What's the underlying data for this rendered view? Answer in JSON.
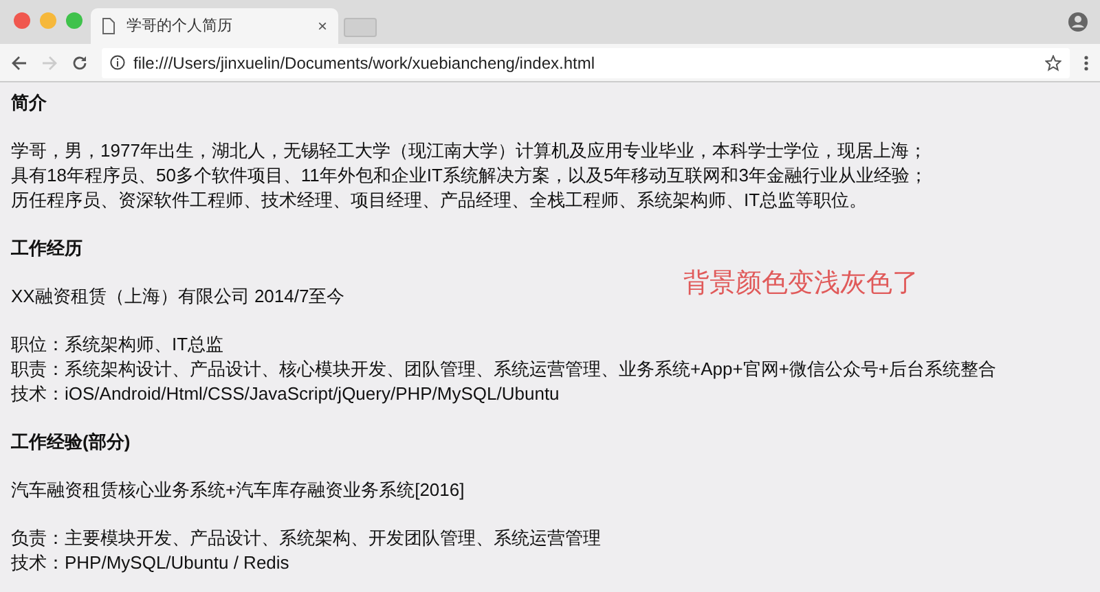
{
  "tab": {
    "title": "学哥的个人简历",
    "close": "×"
  },
  "address_bar": {
    "url": "file:///Users/jinxuelin/Documents/work/xuebiancheng/index.html"
  },
  "sections": [
    {
      "heading": "简介",
      "paragraphs": [
        [
          "学哥，男，1977年出生，湖北人，无锡轻工大学（现江南大学）计算机及应用专业毕业，本科学士学位，现居上海；",
          "具有18年程序员、50多个软件项目、11年外包和企业IT系统解决方案，以及5年移动互联网和3年金融行业从业经验；",
          "历任程序员、资深软件工程师、技术经理、项目经理、产品经理、全栈工程师、系统架构师、IT总监等职位。"
        ]
      ]
    },
    {
      "heading": "工作经历",
      "paragraphs": [
        [
          "XX融资租赁（上海）有限公司 2014/7至今"
        ],
        [
          "职位：系统架构师、IT总监",
          "职责：系统架构设计、产品设计、核心模块开发、团队管理、系统运营管理、业务系统+App+官网+微信公众号+后台系统整合",
          "技术：iOS/Android/Html/CSS/JavaScript/jQuery/PHP/MySQL/Ubuntu"
        ]
      ]
    },
    {
      "heading": "工作经验(部分)",
      "paragraphs": [
        [
          "汽车融资租赁核心业务系统+汽车库存融资业务系统[2016]"
        ],
        [
          "负责：主要模块开发、产品设计、系统架构、开发团队管理、系统运营管理",
          "技术：PHP/MySQL/Ubuntu / Redis"
        ]
      ]
    }
  ],
  "annotation": "背景颜色变浅灰色了"
}
